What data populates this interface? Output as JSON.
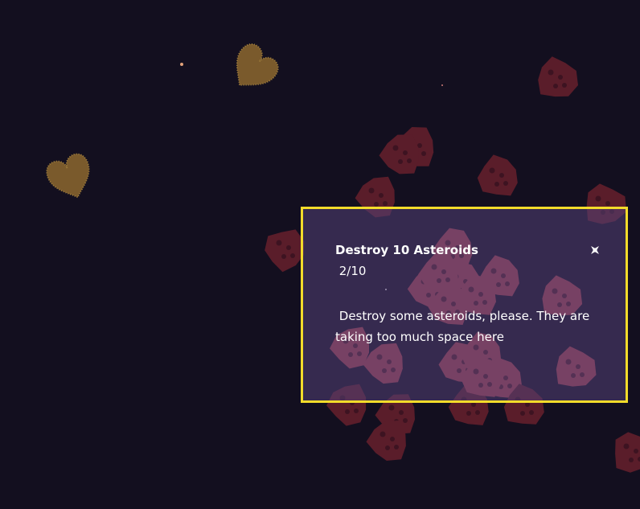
{
  "quest": {
    "title": "Destroy 10 Asteroids",
    "progress": " 2/10",
    "description": " Destroy some asteroids, please. They are taking too much space here",
    "close_icon": "close-star-icon"
  },
  "colors": {
    "background": "#130f1f",
    "asteroid_outside": "#5a1d2a",
    "asteroid_inside": "#a2414f",
    "asteroid_crater": "#3a1320",
    "heart": "#7a5a2c",
    "panel_border": "#f3dc2a",
    "panel_fill": "#3a2d55",
    "text": "#ffffff"
  },
  "sprites": {
    "hearts": 2,
    "asteroids": 34,
    "stars": 3
  }
}
